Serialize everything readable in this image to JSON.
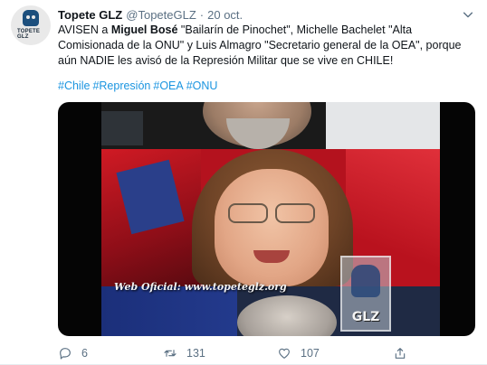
{
  "tweet": {
    "author_name": "Topete GLZ",
    "author_handle": "@TopeteGLZ",
    "separator": "·",
    "time": "20 oct.",
    "avatar_text": "TOPETE GLZ",
    "text_before": "AVISEN a ",
    "text_bold": "Miguel Bosé",
    "text_after": " \"Bailarín de Pinochet\", Michelle Bachelet \"Alta Comisionada de la ONU\" y Luis Almagro \"Secretario general de la OEA\", porque aún NADIE les avisó de la Represión Militar que se vive en CHILE!",
    "hashtags": [
      "#Chile",
      "#Represión",
      "#OEA",
      "#ONU"
    ],
    "media": {
      "watermark": "Web Oficial: www.topeteglz.org",
      "logo_text": "GLZ"
    },
    "actions": {
      "reply_count": "6",
      "retweet_count": "131",
      "like_count": "107"
    }
  },
  "colors": {
    "link": "#1b95e0",
    "secondary_text": "#5b7083",
    "primary_text": "#0f1419"
  },
  "icons": {
    "more": "chevron-down-icon",
    "reply": "reply-icon",
    "retweet": "retweet-icon",
    "like": "heart-icon",
    "share": "share-icon"
  }
}
